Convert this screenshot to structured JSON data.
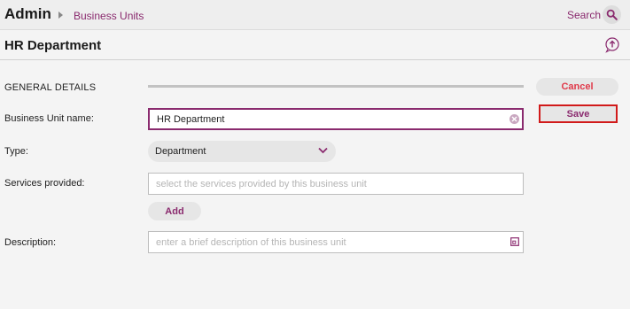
{
  "header": {
    "app_title": "Admin",
    "breadcrumb": "Business Units",
    "search_label": "Search",
    "search_icon": "search-icon"
  },
  "page": {
    "title": "HR Department",
    "action_icon": "upload-icon"
  },
  "section": {
    "title": "GENERAL DETAILS"
  },
  "actions": {
    "cancel_label": "Cancel",
    "save_label": "Save"
  },
  "form": {
    "name": {
      "label": "Business Unit name:",
      "value": "HR Department",
      "clear_icon": "clear-icon"
    },
    "type": {
      "label": "Type:",
      "selected": "Department",
      "chevron_icon": "chevron-down-icon"
    },
    "services": {
      "label": "Services provided:",
      "placeholder": "select the services provided by this business unit",
      "add_label": "Add"
    },
    "description": {
      "label": "Description:",
      "placeholder": "enter a brief description of this business unit",
      "expand_icon": "expand-icon"
    }
  },
  "colors": {
    "accent": "#8a2a6e",
    "cancel": "#e0394a",
    "highlight": "#d11a1a"
  }
}
